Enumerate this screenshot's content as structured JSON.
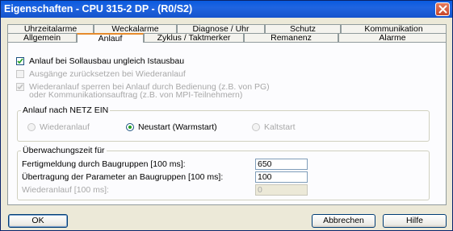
{
  "window": {
    "title": "Eigenschaften - CPU 315-2 DP - (R0/S2)"
  },
  "tabs_back": [
    {
      "label": "Uhrzeitalarme",
      "w": 107
    },
    {
      "label": "Weckalarme",
      "w": 103
    },
    {
      "label": "Diagnose / Uhr",
      "w": 109
    },
    {
      "label": "Schutz",
      "w": 94
    },
    {
      "label": "Kommunikation",
      "w": 131
    }
  ],
  "tabs_front": [
    {
      "label": "Allgemein",
      "w": 86
    },
    {
      "label": "Anlauf",
      "w": 83
    },
    {
      "label": "Zyklus / Taktmerker",
      "w": 124
    },
    {
      "label": "Remanenz",
      "w": 117
    },
    {
      "label": "Alarme",
      "w": 134
    }
  ],
  "options": {
    "anlauf_sollausbau": {
      "label": "Anlauf bei Sollausbau ungleich Istausbau",
      "checked": true
    },
    "ausgaenge_zuruecksetzen": {
      "label": "Ausgänge zurücksetzen bei Wiederanlauf",
      "checked": false
    },
    "wiederanlauf_sperren": {
      "label_line1": "Wiederanlauf sperren bei Anlauf durch Bedienung (z.B. von PG)",
      "label_line2": "oder Kommunikationsauftrag (z.B. von MPI-Teilnehmern)",
      "checked": true
    }
  },
  "netz_ein": {
    "legend": "Anlauf nach NETZ EIN",
    "radios": [
      {
        "label": "Wiederanlauf",
        "selected": false,
        "enabled": false
      },
      {
        "label": "Neustart (Warmstart)",
        "selected": true,
        "enabled": true
      },
      {
        "label": "Kaltstart",
        "selected": false,
        "enabled": false
      }
    ]
  },
  "ueberwachung": {
    "legend": "Überwachungszeit für",
    "fertigmeldung_label": "Fertigmeldung durch Baugruppen [100 ms]:",
    "fertigmeldung_value": "650",
    "uebertragung_label": "Übertragung der Parameter an Baugruppen [100 ms]:",
    "uebertragung_value": "100",
    "wiederanlauf_label": "Wiederanlauf [100 ms]:",
    "wiederanlauf_value": "0"
  },
  "buttons": {
    "ok": "OK",
    "abbrechen": "Abbrechen",
    "hilfe": "Hilfe"
  },
  "colors": {
    "accent_tab": "#e68b2c",
    "titlebar": "#1f64e0",
    "radio_dot": "#21a121"
  }
}
